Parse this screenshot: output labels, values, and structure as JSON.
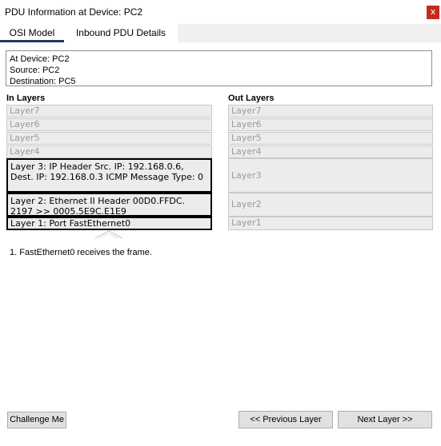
{
  "window": {
    "title": "PDU Information at Device: PC2",
    "close_label": "x"
  },
  "tabs": [
    {
      "label": "OSI Model",
      "selected": true
    },
    {
      "label": "Inbound PDU Details",
      "selected": false
    }
  ],
  "info": {
    "device": "At Device: PC2",
    "source": "Source: PC2",
    "destination": "Destination: PC5"
  },
  "in_layers": {
    "heading": "In Layers",
    "layers": [
      {
        "label": "Layer7",
        "active": false
      },
      {
        "label": "Layer6",
        "active": false
      },
      {
        "label": "Layer5",
        "active": false
      },
      {
        "label": "Layer4",
        "active": false
      },
      {
        "label": "Layer 3: IP Header Src. IP: 192.168.0.6, Dest. IP: 192.168.0.3 ICMP Message Type: 0",
        "active": true
      },
      {
        "label": "Layer 2: Ethernet II Header 00D0.FFDC. 2197 >> 0005.5E9C.E1E9",
        "active": true
      },
      {
        "label": "Layer 1: Port FastEthernet0",
        "active": true
      }
    ]
  },
  "out_layers": {
    "heading": "Out Layers",
    "layers": [
      {
        "label": "Layer7",
        "active": false
      },
      {
        "label": "Layer6",
        "active": false
      },
      {
        "label": "Layer5",
        "active": false
      },
      {
        "label": "Layer4",
        "active": false
      },
      {
        "label": "Layer3",
        "active": false
      },
      {
        "label": "Layer2",
        "active": false
      },
      {
        "label": "Layer1",
        "active": false
      }
    ]
  },
  "steps": [
    "1. FastEthernet0 receives the frame."
  ],
  "buttons": {
    "challenge": "Challenge Me",
    "previous": "<< Previous Layer",
    "next": "Next Layer >>"
  },
  "colors": {
    "close": "#c42b1c",
    "tab_underline": "#1e3a5f",
    "layer_bg": "#ececec"
  }
}
